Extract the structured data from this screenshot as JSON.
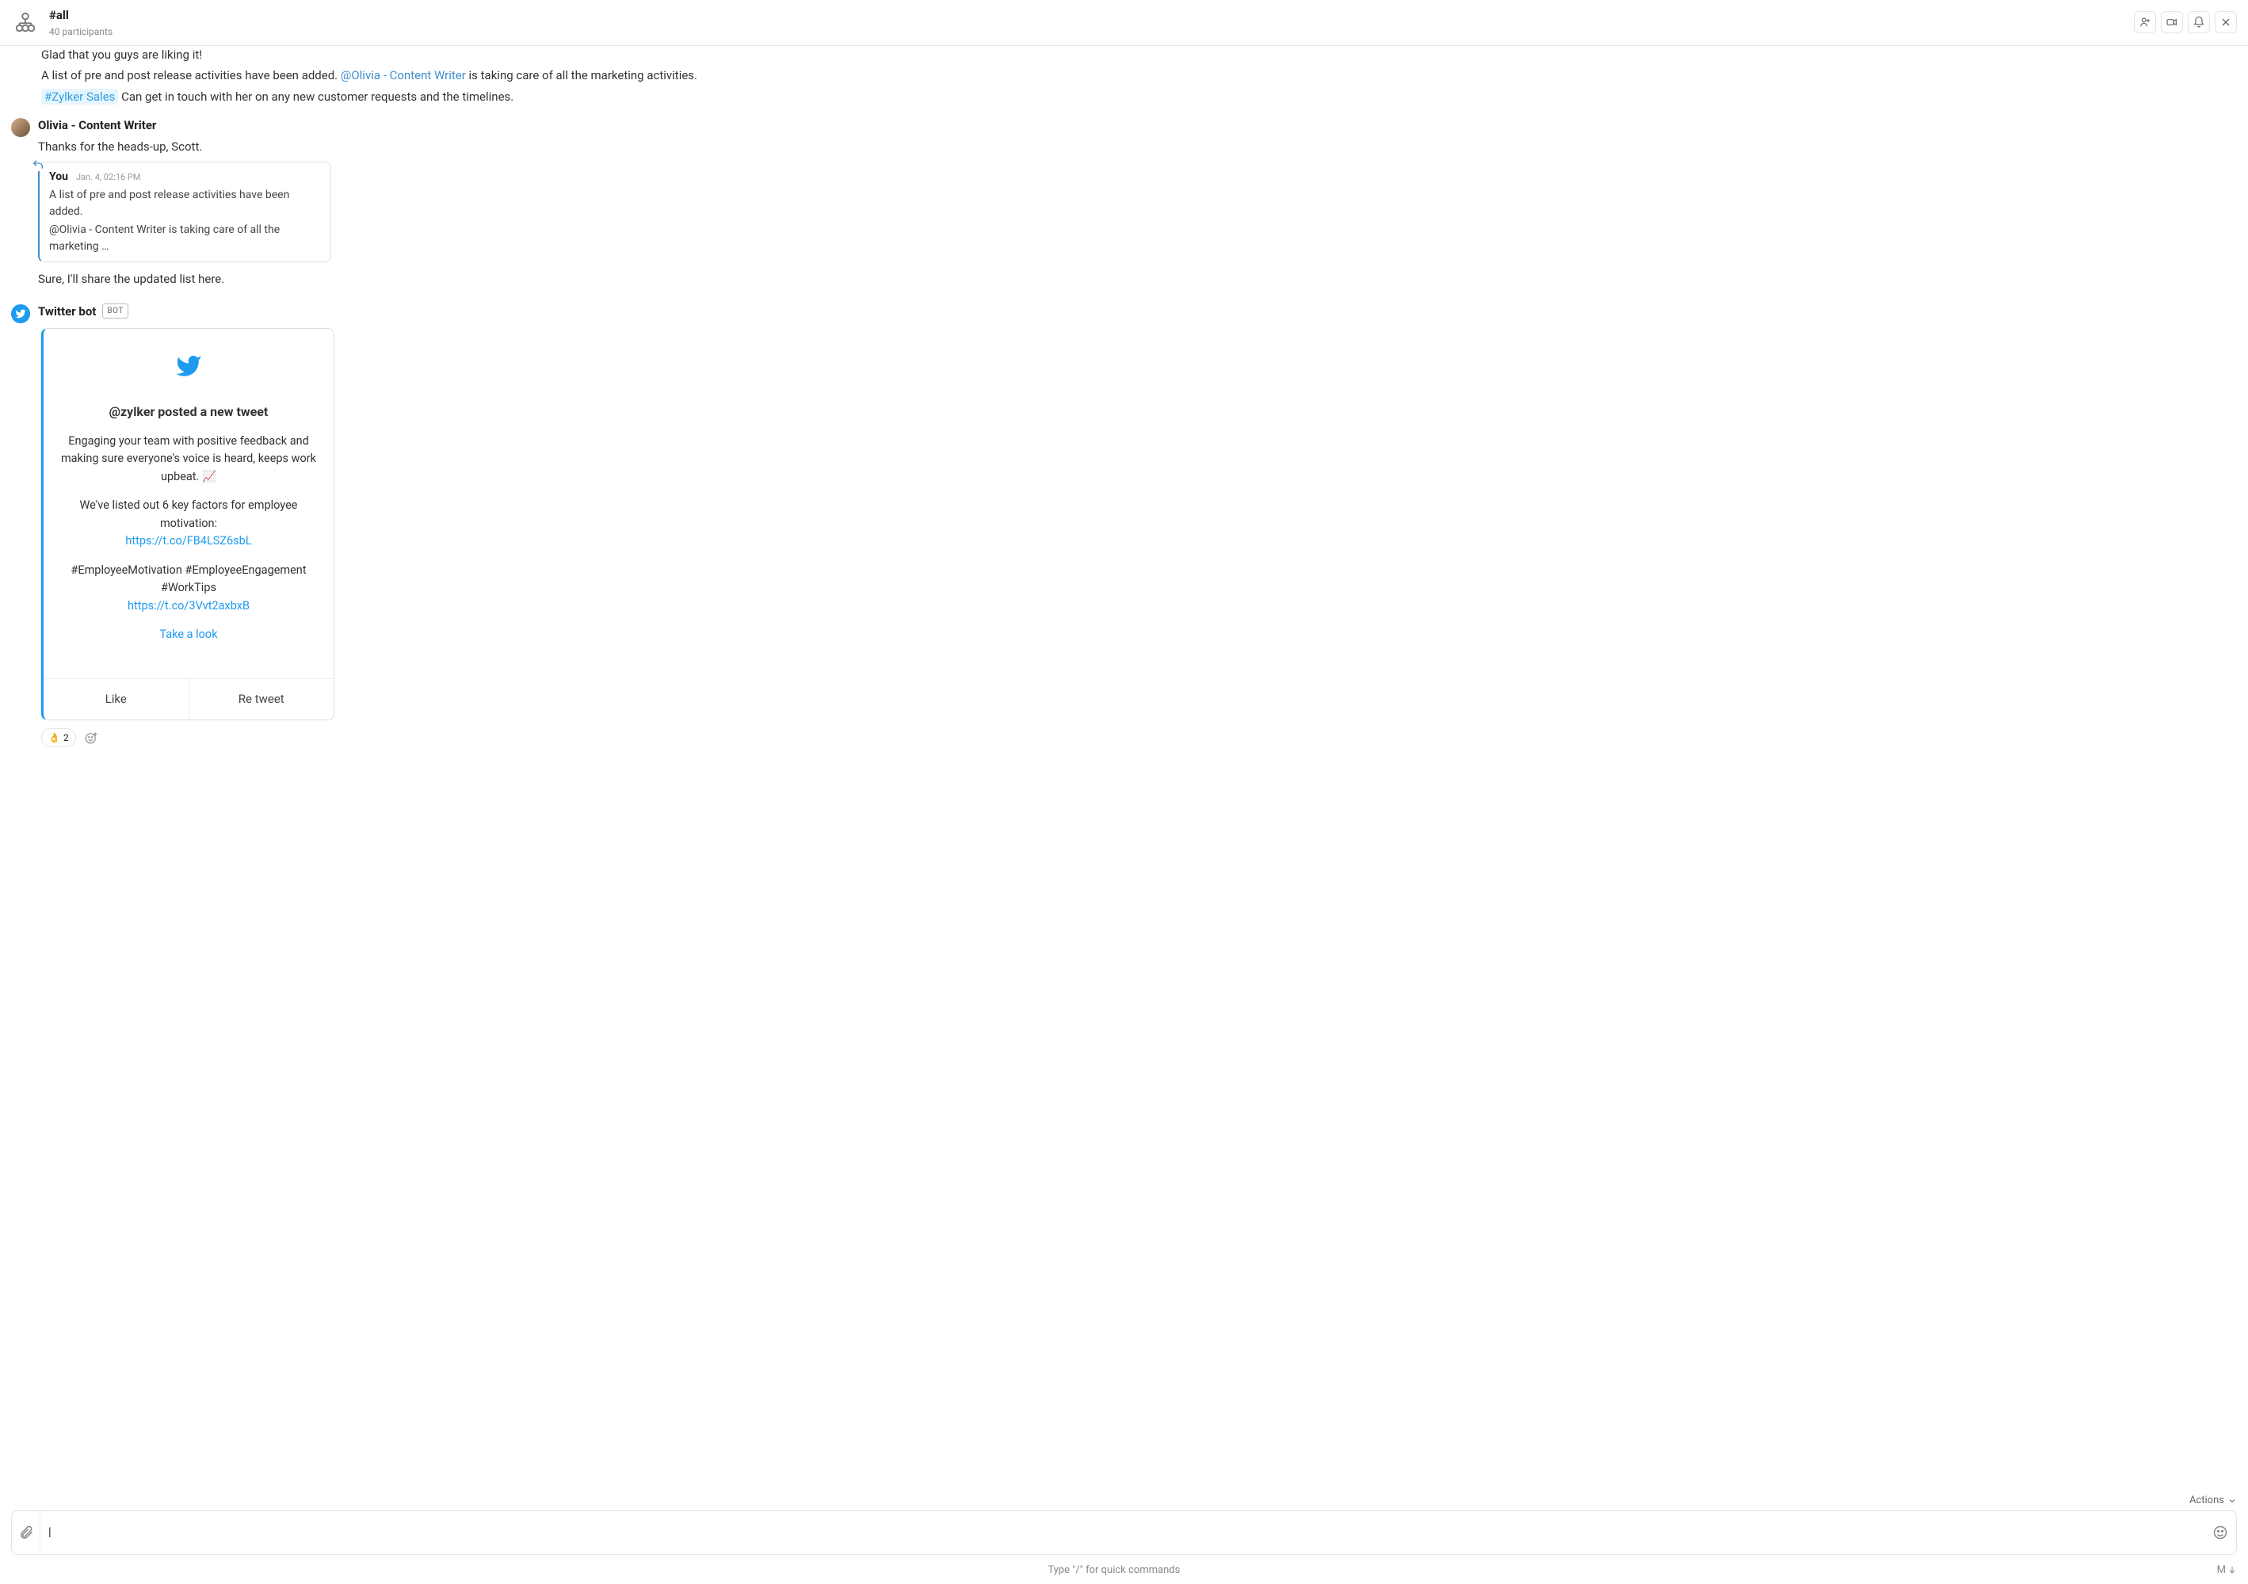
{
  "header": {
    "channel_name": "#all",
    "participants": "40 participants"
  },
  "messages": {
    "scott": {
      "line1": "Glad that you guys are liking it!",
      "line2a": "A list of pre and post release activities have been added. ",
      "mention": "@Olivia - Content Writer",
      "line2b": " is taking care of all the marketing activities.",
      "hashtag": "#Zylker Sales",
      "line3b": "  Can get in touch with her on any new customer requests and the timelines."
    },
    "olivia": {
      "author": "Olivia - Content Writer",
      "line1": "Thanks for the heads-up, Scott.",
      "quote": {
        "author": "You",
        "time": "Jan. 4, 02:16 PM",
        "l1": "A list of pre and post release activities have been added.",
        "l2": "@Olivia - Content Writer is taking care of all the marketing …"
      },
      "line2": "Sure, I'll share the updated list here."
    },
    "twitter": {
      "author": "Twitter bot",
      "badge": "BOT",
      "card": {
        "title": "@zylker posted a new tweet",
        "p1": "Engaging your team with positive feedback and making sure everyone's voice is heard, keeps work upbeat. 📈",
        "p2": "We've listed out 6 key factors for employee motivation:",
        "link1": "https://t.co/FB4LSZ6sbL",
        "p3": "#EmployeeMotivation  #EmployeeEngagement #WorkTips",
        "link2": "https://t.co/3Vvt2axbxB",
        "cta": "Take a look",
        "btn_like": "Like",
        "btn_retweet": "Re tweet"
      },
      "reaction": {
        "emoji": "👌",
        "count": "2"
      }
    }
  },
  "composer": {
    "actions_label": "Actions",
    "placeholder": "",
    "hint_center": "Type \"/\" for quick commands",
    "hint_right": "M"
  }
}
